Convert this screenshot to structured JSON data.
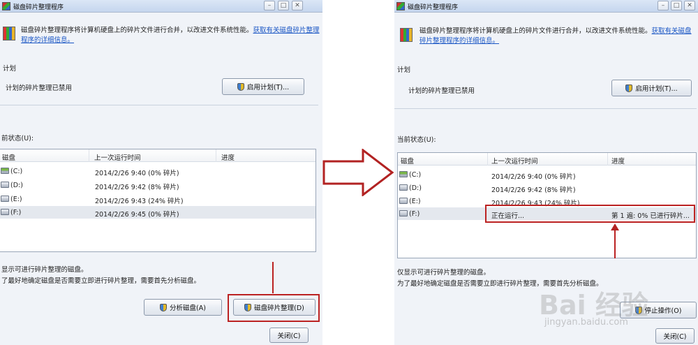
{
  "left": {
    "title": "磁盘碎片整理程序",
    "description": "磁盘碎片整理程序将计算机硬盘上的碎片文件进行合并，以改进文件系统性能。",
    "help_link": "获取有关磁盘碎片整理程序的详细信息。",
    "schedule_label": "计划",
    "schedule_status": "计划的碎片整理已禁用",
    "configure_schedule_button": "启用计划(T)...",
    "current_status_label": "前状态(U):",
    "columns": [
      "磁盘",
      "上一次运行时间",
      "进度"
    ],
    "rows": [
      {
        "disk": "(C:)",
        "last_run": "2014/2/26 9:40 (0% 碎片)",
        "progress": ""
      },
      {
        "disk": "(D:)",
        "last_run": "2014/2/26 9:42 (8% 碎片)",
        "progress": ""
      },
      {
        "disk": "(E:)",
        "last_run": "2014/2/26 9:43 (24% 碎片)",
        "progress": ""
      },
      {
        "disk": "(F:)",
        "last_run": "2014/2/26 9:45 (0% 碎片)",
        "progress": ""
      }
    ],
    "footer_line1": "显示可进行碎片整理的磁盘。",
    "footer_line2": "了最好地确定磁盘是否需要立即进行碎片整理，需要首先分析磁盘。",
    "analyze_button": "分析磁盘(A)",
    "defrag_button": "磁盘碎片整理(D)",
    "close_button": "关闭(C)"
  },
  "right": {
    "title": "磁盘碎片整理程序",
    "description": "磁盘碎片整理程序将计算机硬盘上的碎片文件进行合并，以改进文件系统性能。",
    "help_link": "获取有关磁盘碎片整理程序的详细信息。",
    "schedule_label": "计划",
    "schedule_status": "计划的碎片整理已禁用",
    "configure_schedule_button": "启用计划(T)...",
    "current_status_label": "当前状态(U):",
    "columns": [
      "磁盘",
      "上一次运行时间",
      "进度"
    ],
    "rows": [
      {
        "disk": "(C:)",
        "last_run": "2014/2/26 9:40 (0% 碎片)",
        "progress": ""
      },
      {
        "disk": "(D:)",
        "last_run": "2014/2/26 9:42 (8% 碎片)",
        "progress": ""
      },
      {
        "disk": "(E:)",
        "last_run": "2014/2/26 9:43 (24% 碎片)",
        "progress": ""
      },
      {
        "disk": "(F:)",
        "last_run": "正在运行...",
        "progress": "第 1 遍: 0% 已进行碎片..."
      }
    ],
    "footer_line1": "仅显示可进行碎片整理的磁盘。",
    "footer_line2": "为了最好地确定磁盘是否需要立即进行碎片整理，需要首先分析磁盘。",
    "stop_button": "停止操作(O)",
    "close_button": "关闭(C)"
  },
  "watermark": {
    "text": "Bai 经验",
    "sub": "jingyan.baidu.com"
  },
  "colors": {
    "annotation_red": "#b22222",
    "window_bg": "#f0f3f8",
    "link": "#1a56c4"
  }
}
